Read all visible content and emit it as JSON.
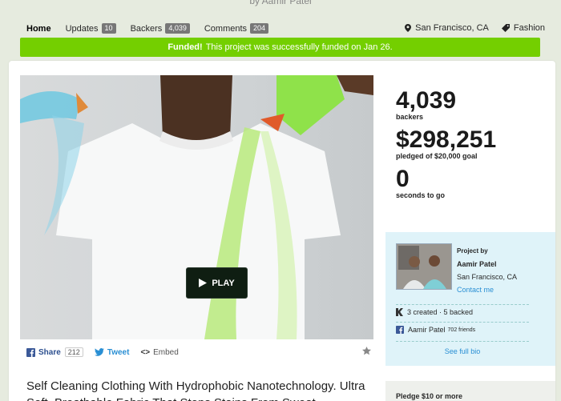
{
  "header_cut_text": "by Aamir Patel",
  "nav": {
    "home": "Home",
    "updates": "Updates",
    "updates_count": "10",
    "backers": "Backers",
    "backers_count": "4,039",
    "comments": "Comments",
    "comments_count": "204",
    "location": "San Francisco, CA",
    "category": "Fashion"
  },
  "funded": {
    "strong": "Funded!",
    "text": "This project was successfully funded on Jan 26."
  },
  "video": {
    "play_label": "PLAY"
  },
  "share": {
    "share_label": "Share",
    "share_count": "212",
    "tweet_label": "Tweet",
    "embed_label": "Embed"
  },
  "title": "Self Cleaning Clothing With Hydrophobic Nanotechnology. Ultra Soft, Breathable Fabric That Stops Stains From Sweat",
  "stats": {
    "backers_value": "4,039",
    "backers_label": "backers",
    "pledged_value": "$298,251",
    "pledged_label": "pledged of $20,000 goal",
    "time_value": "0",
    "time_label": "seconds to go"
  },
  "creator": {
    "label": "Project by",
    "name": "Aamir Patel",
    "location": "San Francisco, CA",
    "contact": "Contact me",
    "history": "3 created · 5 backed",
    "facebook_name": "Aamir Patel",
    "facebook_friends": "702 friends",
    "full_bio": "See full bio"
  },
  "pledge": {
    "label": "Pledge $10 or more"
  },
  "colors": {
    "funded_green": "#74cf00",
    "link_blue": "#2a8fd4",
    "creator_bg": "#dff3f9"
  }
}
